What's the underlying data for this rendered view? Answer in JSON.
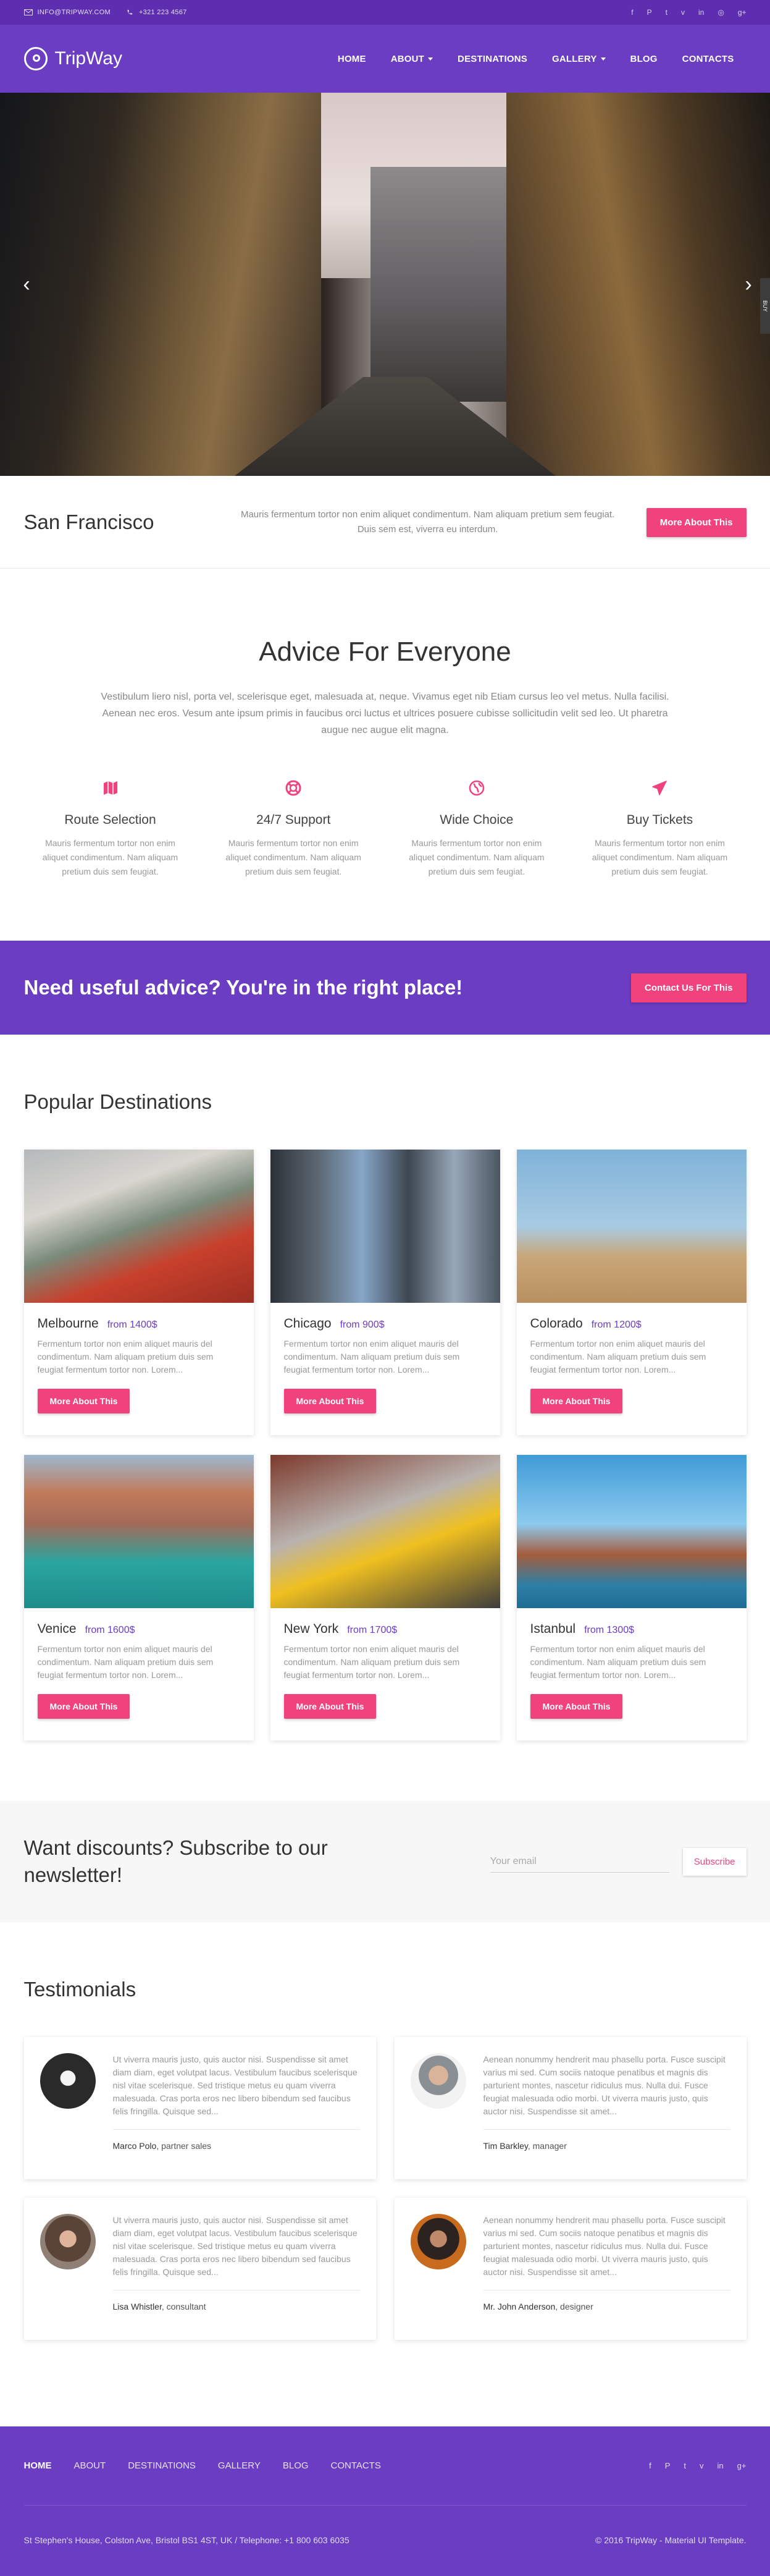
{
  "topbar": {
    "email": "INFO@TRIPWAY.COM",
    "phone": "+321 223 4567",
    "social": [
      "f",
      "P",
      "t",
      "v",
      "in",
      "◎",
      "g+"
    ]
  },
  "header": {
    "logo": "TripWay",
    "nav": [
      {
        "label": "HOME",
        "dropdown": false
      },
      {
        "label": "ABOUT",
        "dropdown": true
      },
      {
        "label": "DESTINATIONS",
        "dropdown": false
      },
      {
        "label": "GALLERY",
        "dropdown": true
      },
      {
        "label": "BLOG",
        "dropdown": false
      },
      {
        "label": "CONTACTS",
        "dropdown": false
      }
    ]
  },
  "hero": {
    "prev_icon": "‹",
    "next_icon": "›",
    "side_tab": "BUY"
  },
  "city": {
    "title": "San Francisco",
    "text": "Mauris fermentum tortor non enim aliquet condimentum. Nam aliquam pretium sem feugiat. Duis sem est, viverra eu interdum.",
    "button": "More About This"
  },
  "advice": {
    "title": "Advice For Everyone",
    "lead": "Vestibulum liero nisl, porta vel, scelerisque eget, malesuada at, neque. Vivamus eget nib Etiam cursus leo vel metus. Nulla facilisi. Aenean nec eros. Vesum ante ipsum primis in faucibus orci luctus et ultrices posuere cubisse sollicitudin velit sed leo. Ut pharetra augue nec augue elit magna.",
    "features": [
      {
        "icon": "map-icon",
        "title": "Route Selection",
        "text": "Mauris fermentum tortor non enim aliquet condimentum. Nam aliquam pretium duis sem feugiat."
      },
      {
        "icon": "lifebuoy-icon",
        "title": "24/7 Support",
        "text": "Mauris fermentum tortor non enim aliquet condimentum. Nam aliquam pretium duis sem feugiat."
      },
      {
        "icon": "globe-icon",
        "title": "Wide Choice",
        "text": "Mauris fermentum tortor non enim aliquet condimentum. Nam aliquam pretium duis sem feugiat."
      },
      {
        "icon": "airplane-icon",
        "title": "Buy Tickets",
        "text": "Mauris fermentum tortor non enim aliquet condimentum. Nam aliquam pretium duis sem feugiat."
      }
    ]
  },
  "cta": {
    "title": "Need useful advice? You're in the right place!",
    "button": "Contact Us For This"
  },
  "destinations": {
    "title": "Popular Destinations",
    "button": "More About This",
    "items": [
      {
        "name": "Melbourne",
        "price": "from 1400$",
        "text": "Fermentum tortor non enim aliquet mauris del condimentum. Nam aliquam pretium duis sem feugiat fermentum tortor non. Lorem..."
      },
      {
        "name": "Chicago",
        "price": "from 900$",
        "text": "Fermentum tortor non enim aliquet mauris del condimentum. Nam aliquam pretium duis sem feugiat fermentum tortor non. Lorem..."
      },
      {
        "name": "Colorado",
        "price": "from 1200$",
        "text": "Fermentum tortor non enim aliquet mauris del condimentum. Nam aliquam pretium duis sem feugiat fermentum tortor non. Lorem..."
      },
      {
        "name": "Venice",
        "price": "from 1600$",
        "text": "Fermentum tortor non enim aliquet mauris del condimentum. Nam aliquam pretium duis sem feugiat fermentum tortor non. Lorem..."
      },
      {
        "name": "New York",
        "price": "from 1700$",
        "text": "Fermentum tortor non enim aliquet mauris del condimentum. Nam aliquam pretium duis sem feugiat fermentum tortor non. Lorem..."
      },
      {
        "name": "Istanbul",
        "price": "from 1300$",
        "text": "Fermentum tortor non enim aliquet mauris del condimentum. Nam aliquam pretium duis sem feugiat fermentum tortor non. Lorem..."
      }
    ]
  },
  "newsletter": {
    "title": "Want discounts? Subscribe to our newsletter!",
    "placeholder": "Your email",
    "button": "Subscribe"
  },
  "testimonials": {
    "title": "Testimonials",
    "items": [
      {
        "text": "Ut viverra mauris justo, quis auctor nisi. Suspendisse sit amet diam diam, eget volutpat lacus. Vestibulum faucibus scelerisque nisl vitae scelerisque. Sed tristique metus eu quam viverra malesuada. Cras porta eros nec libero bibendum sed faucibus felis fringilla. Quisque sed...",
        "name": "Marco Polo",
        "role": ", partner sales"
      },
      {
        "text": "Aenean nonummy hendrerit mau phasellu porta. Fusce suscipit varius mi sed. Cum sociis natoque penatibus et magnis dis parturient montes, nascetur ridiculus mus. Nulla dui. Fusce feugiat malesuada odio morbi. Ut viverra mauris justo, quis auctor nisi. Suspendisse sit amet...",
        "name": "Tim Barkley",
        "role": ", manager"
      },
      {
        "text": "Ut viverra mauris justo, quis auctor nisi. Suspendisse sit amet diam diam, eget volutpat lacus. Vestibulum faucibus scelerisque nisl vitae scelerisque. Sed tristique metus eu quam viverra malesuada. Cras porta eros nec libero bibendum sed faucibus felis fringilla. Quisque sed...",
        "name": "Lisa Whistler",
        "role": ", consultant"
      },
      {
        "text": "Aenean nonummy hendrerit mau phasellu porta. Fusce suscipit varius mi sed. Cum sociis natoque penatibus et magnis dis parturient montes, nascetur ridiculus mus. Nulla dui. Fusce feugiat malesuada odio morbi. Ut viverra mauris justo, quis auctor nisi. Suspendisse sit amet...",
        "name": "Mr. John Anderson",
        "role": ", designer"
      }
    ]
  },
  "footer": {
    "nav": [
      "HOME",
      "ABOUT",
      "DESTINATIONS",
      "GALLERY",
      "BLOG",
      "CONTACTS"
    ],
    "social": [
      "f",
      "P",
      "t",
      "v",
      "in",
      "g+"
    ],
    "address": "St Stephen's House, Colston Ave, Bristol BS1 4ST, UK / Telephone: +1 800 603 6035",
    "copyright": "© 2016 TripWay - Material UI Template."
  },
  "colors": {
    "primary": "#6a3dc2",
    "topbar": "#5d2fb0",
    "accent": "#f0437d"
  }
}
